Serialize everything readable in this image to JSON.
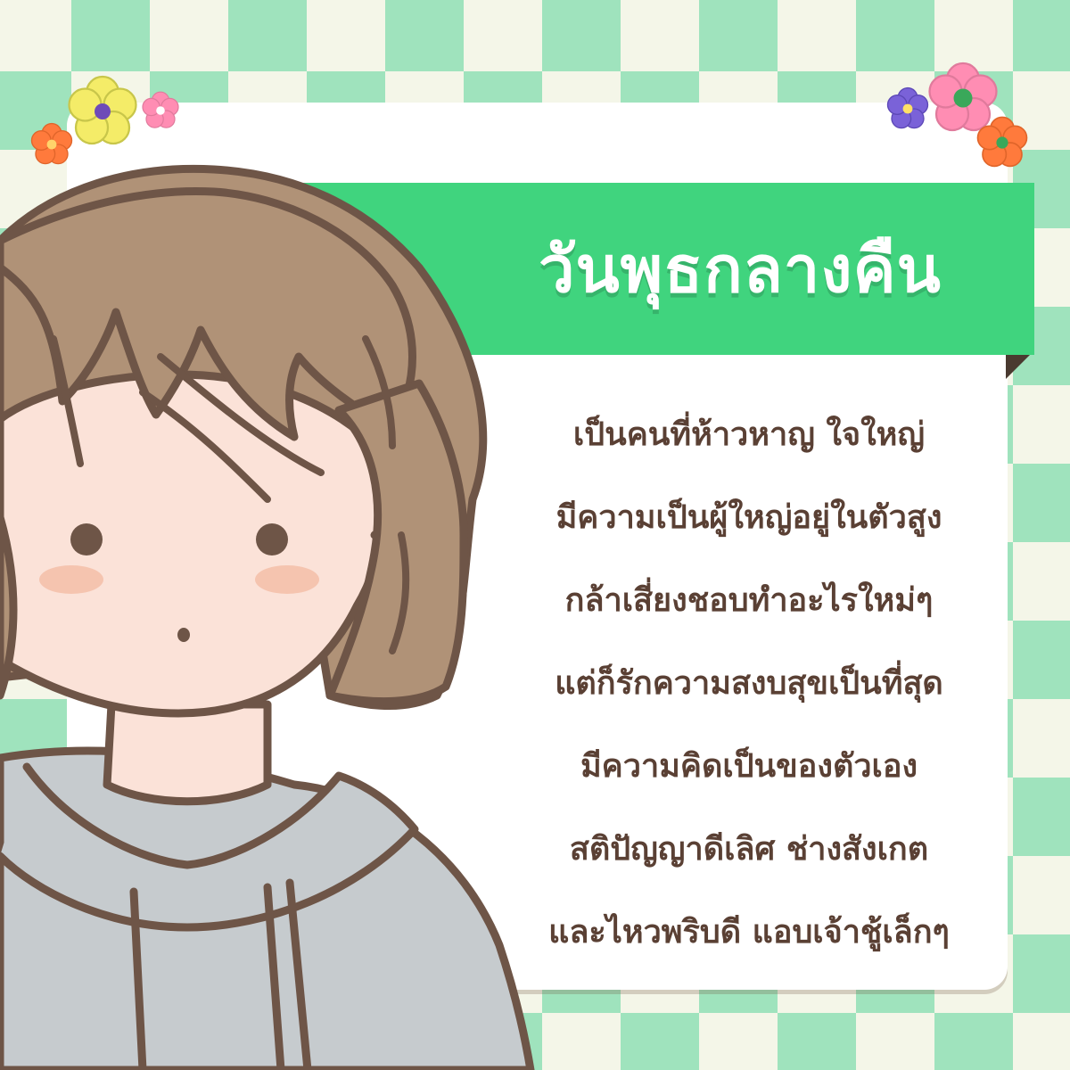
{
  "title": "วันพุธกลางคืน",
  "traits": [
    "เป็นคนที่ห้าวหาญ ใจใหญ่",
    "มีความเป็นผู้ใหญ่อยู่ในตัวสูง",
    "กล้าเสี่ยงชอบทำอะไรใหม่ๆ",
    "แต่ก็รักความสงบสุขเป็นที่สุด",
    "มีความคิดเป็นของตัวเอง",
    "สติปัญญาดีเลิศ ช่างสังเกต",
    "และไหวพริบดี แอบเจ้าชู้เล็กๆ"
  ],
  "icons": [
    "flower-icon",
    "character-illustration"
  ],
  "colors": {
    "accent": "#40d47e",
    "checker_green": "#9fe3bd",
    "text_brown": "#5a4034",
    "hair": "#b09277",
    "hoodie": "#c6cbce"
  }
}
